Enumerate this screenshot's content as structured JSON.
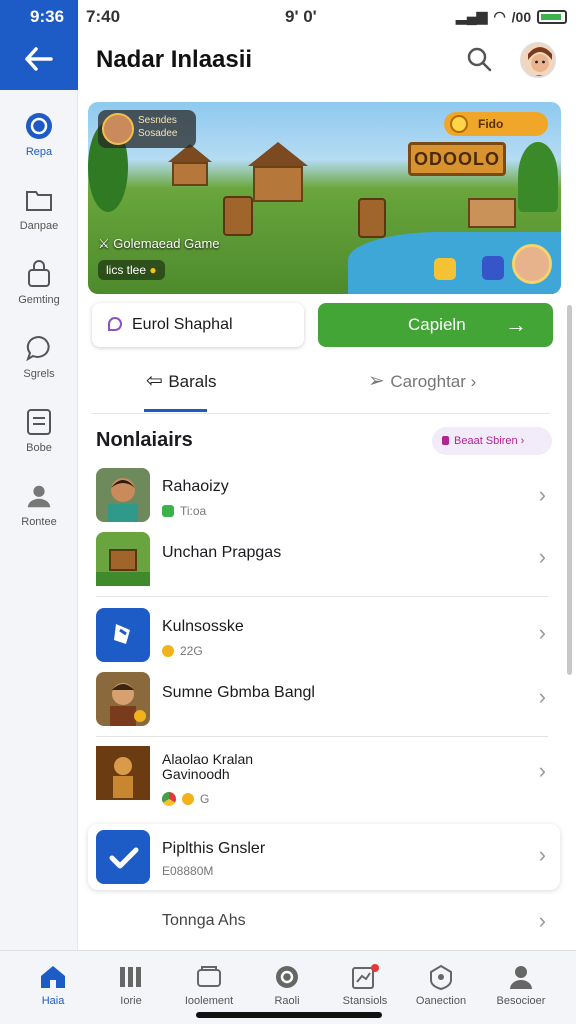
{
  "status": {
    "time_left": "9:36",
    "time": "7:40",
    "center": "9' 0'",
    "signal": "/00"
  },
  "header": {
    "title": "Nadar Inlaasii"
  },
  "rail": [
    {
      "label": "Repa",
      "icon": "refresh-icon"
    },
    {
      "label": "Danpae",
      "icon": "folder-icon"
    },
    {
      "label": "Gemting",
      "icon": "lock-icon"
    },
    {
      "label": "Sgrels",
      "icon": "chat-icon"
    },
    {
      "label": "Bobe",
      "icon": "card-icon"
    },
    {
      "label": "Rontee",
      "icon": "person-icon"
    }
  ],
  "banner": {
    "card_line1": "Sesndes",
    "card_line2": "Sosadee",
    "coin_label": "Fido",
    "sign_text": "ODOOLO",
    "caption": "Golemaead Game",
    "caption2": "lics tlee"
  },
  "actions": {
    "secondary": "Eurol Shaphal",
    "primary": "Capieln",
    "primary_arrow": "→"
  },
  "tabs": [
    {
      "label": "Barals",
      "active": true
    },
    {
      "label": "Caroghtar",
      "active": false
    }
  ],
  "section": {
    "title": "Nonlaiairs",
    "chip": "Beaat Sbiren"
  },
  "list": [
    {
      "name": "Rahaoizy",
      "sub": "Ti:oa",
      "badge": "green",
      "color": "#6e8a5c"
    },
    {
      "name": "Unchan Prapgas",
      "sub": "",
      "badge": "",
      "color": "#6aa43e"
    },
    {
      "name": "Kulnsosske",
      "sub": "22G",
      "badge": "yellow",
      "color": "#1d5bc6"
    },
    {
      "name": "Sumne Gbmba Bangl",
      "sub": "",
      "badge": "",
      "color": "#8a6a3c"
    },
    {
      "name": "Alaolao Kralan",
      "name2": "Gavinoodh",
      "sub": "G",
      "badge": "chrome",
      "color": "#a06a2a"
    },
    {
      "name": "Piplthis Gnsler",
      "sub": "E08880M",
      "badge": "",
      "color": "#1d5bc6"
    },
    {
      "name": "Tonnga Ahs",
      "sub": "",
      "badge": "",
      "color": ""
    }
  ],
  "bottom_nav": [
    {
      "label": "Haia",
      "icon": "home-icon",
      "active": true
    },
    {
      "label": "Iorie",
      "icon": "library-icon"
    },
    {
      "label": "Ioolement",
      "icon": "folder-icon"
    },
    {
      "label": "Raoli",
      "icon": "refresh-icon"
    },
    {
      "label": "Stansiols",
      "icon": "chart-icon"
    },
    {
      "label": "Oanection",
      "icon": "shield-icon"
    },
    {
      "label": "Besocioer",
      "icon": "profile-icon"
    }
  ]
}
